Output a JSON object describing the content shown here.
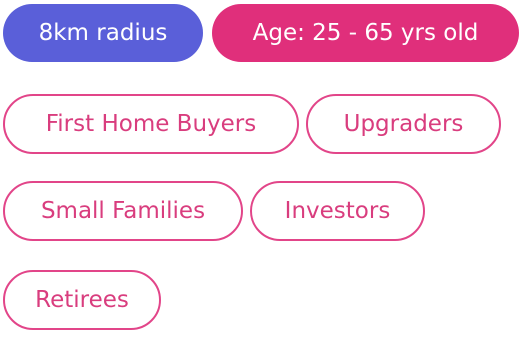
{
  "filters": {
    "radius_label": "8km radius",
    "age_label": "Age: 25 - 65 yrs old"
  },
  "segments": {
    "first_home_buyers": "First Home Buyers",
    "upgraders": "Upgraders",
    "small_families": "Small Families",
    "investors": "Investors",
    "retirees": "Retirees"
  },
  "colors": {
    "radius_chip": "#5a5fd9",
    "age_chip": "#e02f7b",
    "outline_accent": "#e24589"
  }
}
